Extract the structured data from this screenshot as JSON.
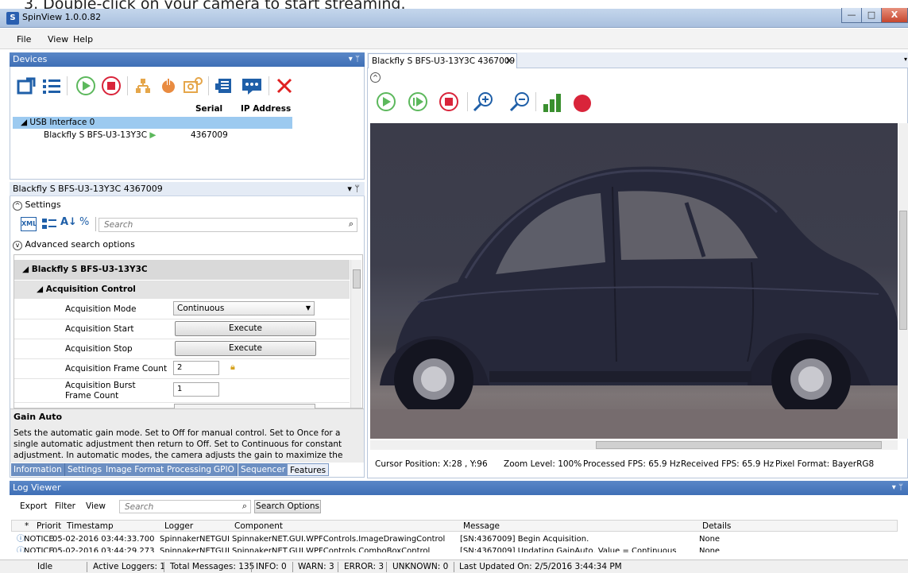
{
  "instruction": "3.  Double-click on your camera to start streaming.",
  "window": {
    "title": "SpinView 1.0.0.82",
    "icon_letter": "S",
    "close_label": "X"
  },
  "menu": [
    "File",
    "View",
    "Help"
  ],
  "devices_panel": {
    "title": "Devices",
    "columns": {
      "serial": "Serial",
      "ip": "IP Address"
    },
    "interface": "USB Interface 0",
    "camera": {
      "name": "Blackfly S BFS-U3-13Y3C",
      "serial": "4367009"
    }
  },
  "features_panel": {
    "title": "Blackfly S BFS-U3-13Y3C 4367009",
    "settings_label": "Settings",
    "xml_label": "XML",
    "search_placeholder": "Search",
    "advanced_search": "Advanced search options",
    "root_node": "Blackfly S BFS-U3-13Y3C",
    "category": "Acquisition Control",
    "rows": {
      "acq_mode": {
        "label": "Acquisition Mode",
        "value": "Continuous"
      },
      "acq_start": {
        "label": "Acquisition Start",
        "value": "Execute"
      },
      "acq_stop": {
        "label": "Acquisition Stop",
        "value": "Execute"
      },
      "acq_frame_count": {
        "label": "Acquisition Frame Count",
        "value": "2"
      },
      "acq_burst": {
        "label": "Acquisition Burst Frame Count",
        "value": "1"
      }
    },
    "description_title": "Gain Auto",
    "description_text": "Sets the automatic gain mode. Set to Off for manual control. Set to Once for a single automatic adjustment then return to Off. Set to Continuous for constant adjustment. In automatic modes, the camera adjusts the gain to maximize the dynamic range.",
    "tabs": [
      "Information",
      "Settings",
      "Image Format",
      "Processing",
      "GPIO",
      "Sequencer",
      "Features"
    ],
    "selected_tab": "Features"
  },
  "stream_panel": {
    "tab_title": "Blackfly S BFS-U3-13Y3C 4367009",
    "status": {
      "cursor": "Cursor Position: X:28 , Y:96",
      "zoom": "Zoom Level: 100%",
      "processed_fps": "Processed FPS: 65.9 Hz",
      "received_fps": "Received FPS: 65.9 Hz",
      "pixel_format": "Pixel Format: BayerRG8"
    }
  },
  "log_viewer": {
    "title": "Log Viewer",
    "toolbar": {
      "export": "Export",
      "filter": "Filter",
      "view": "View",
      "search_placeholder": "Search",
      "search_options": "Search Options"
    },
    "columns": {
      "star": "*",
      "priority": "Priorit",
      "timestamp": "Timestamp",
      "logger": "Logger",
      "component": "Component",
      "message": "Message",
      "details": "Details"
    },
    "rows": [
      {
        "priority": "NOTICE",
        "timestamp": "05-02-2016 03:44:33.700",
        "logger": "SpinnakerNETGUI",
        "component": "SpinnakerNET.GUI.WPFControls.ImageDrawingControl",
        "message": "[SN:4367009] Begin Acquisition.",
        "details": "None"
      },
      {
        "priority": "NOTICE",
        "timestamp": "05-02-2016 03:44:29.273",
        "logger": "SpinnakerNETGUI",
        "component": "SpinnakerNET.GUI.WPFControls.ComboBoxControl",
        "message": "[SN:4367009] Updating GainAuto. Value = Continuous",
        "details": "None"
      }
    ]
  },
  "statusbar": {
    "state": "Idle",
    "active_loggers": "Active Loggers: 1",
    "total_messages": "Total Messages: 135",
    "info": "INFO: 0",
    "warn": "WARN: 3",
    "error": "ERROR: 3",
    "unknown": "UNKNOWN: 0",
    "last_updated": "Last Updated On: 2/5/2016 3:44:34 PM"
  },
  "colors": {
    "play": "#5cb85c",
    "stop": "#d9243a",
    "accent_blue": "#1f5fa8",
    "close_red": "#e02020"
  }
}
